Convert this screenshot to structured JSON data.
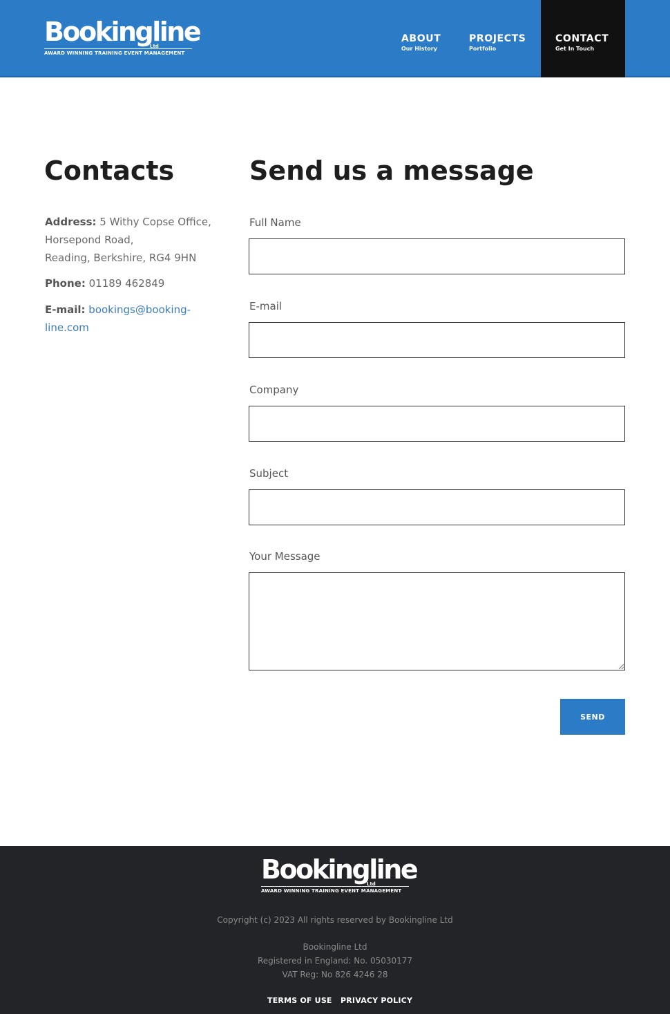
{
  "brand": {
    "name": "Bookingline",
    "suffix": "Ltd",
    "tagline": "AWARD WINNING TRAINING EVENT MANAGEMENT",
    "color": "#2b7bc6"
  },
  "nav": {
    "items": [
      {
        "label": "ABOUT",
        "sub": "Our History"
      },
      {
        "label": "PROJECTS",
        "sub": "Portfolio"
      },
      {
        "label": "CONTACT",
        "sub": "Get In Touch",
        "active": true
      }
    ]
  },
  "contacts": {
    "title": "Contacts",
    "address_label": "Address:",
    "address_lines": [
      "5 Withy Copse Office,",
      "Horsepond Road,",
      "Reading, Berkshire, RG4 9HN"
    ],
    "phone_label": "Phone:",
    "phone": "01189 462849",
    "email_label": "E-mail:",
    "email_line1": "bookings@booking-",
    "email_line2": "line.com"
  },
  "form": {
    "title": "Send us a message",
    "fields": [
      {
        "label": "Full Name",
        "value": ""
      },
      {
        "label": "E-mail",
        "value": ""
      },
      {
        "label": "Company",
        "value": ""
      },
      {
        "label": "Subject",
        "value": ""
      },
      {
        "label": "Your Message",
        "value": ""
      }
    ],
    "send_label": "SEND"
  },
  "footer": {
    "copyright": "Copyright (c) 2023 All rights reserved by Bookingline Ltd",
    "company": "Bookingline Ltd",
    "registration": "Registered in England: No. 05030177",
    "vat": "VAT Reg: No 826 4246 28",
    "links": [
      "TERMS OF USE",
      "PRIVACY POLICY"
    ],
    "background": "#232427"
  }
}
